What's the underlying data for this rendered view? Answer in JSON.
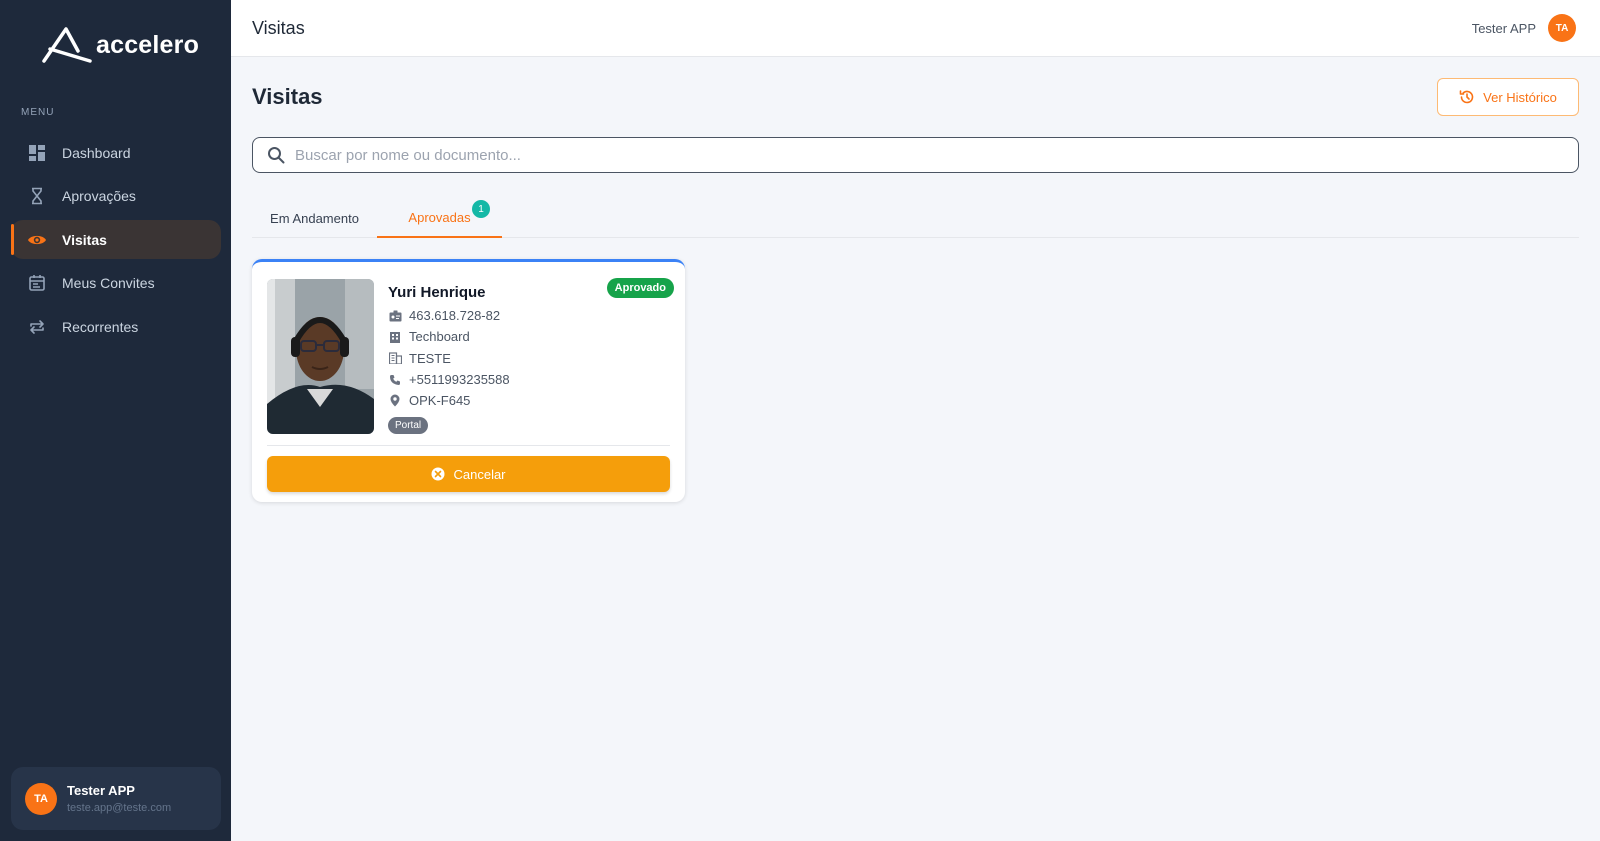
{
  "app": {
    "brand": "accelero",
    "menu_label": "MENU"
  },
  "sidebar": {
    "items": [
      {
        "label": "Dashboard",
        "icon": "dashboard-icon",
        "active": false
      },
      {
        "label": "Aprovações",
        "icon": "hourglass-icon",
        "active": false
      },
      {
        "label": "Visitas",
        "icon": "eye-icon",
        "active": true
      },
      {
        "label": "Meus Convites",
        "icon": "calendar-icon",
        "active": false
      },
      {
        "label": "Recorrentes",
        "icon": "repeat-icon",
        "active": false
      }
    ],
    "user": {
      "initials": "TA",
      "name": "Tester APP",
      "email": "teste.app@teste.com"
    }
  },
  "topbar": {
    "title": "Visitas",
    "user_name": "Tester APP",
    "user_initials": "TA"
  },
  "main": {
    "title": "Visitas",
    "history_button": "Ver Histórico",
    "search_placeholder": "Buscar por nome ou documento...",
    "tabs": [
      {
        "label": "Em Andamento",
        "active": false
      },
      {
        "label": "Aprovadas",
        "active": true,
        "badge": "1"
      }
    ]
  },
  "visit_card": {
    "name": "Yuri Henrique",
    "status": "Aprovado",
    "document": "463.618.728-82",
    "company": "Techboard",
    "destination": "TESTE",
    "phone": "+5511993235588",
    "location": "OPK-F645",
    "origin": "Portal",
    "cancel_label": "Cancelar"
  },
  "colors": {
    "sidebar_bg": "#1e293b",
    "accent": "#f97316",
    "status_approved": "#16a34a",
    "cancel_button": "#f59e0b",
    "badge": "#14b8a6",
    "card_top": "#3b82f6"
  }
}
